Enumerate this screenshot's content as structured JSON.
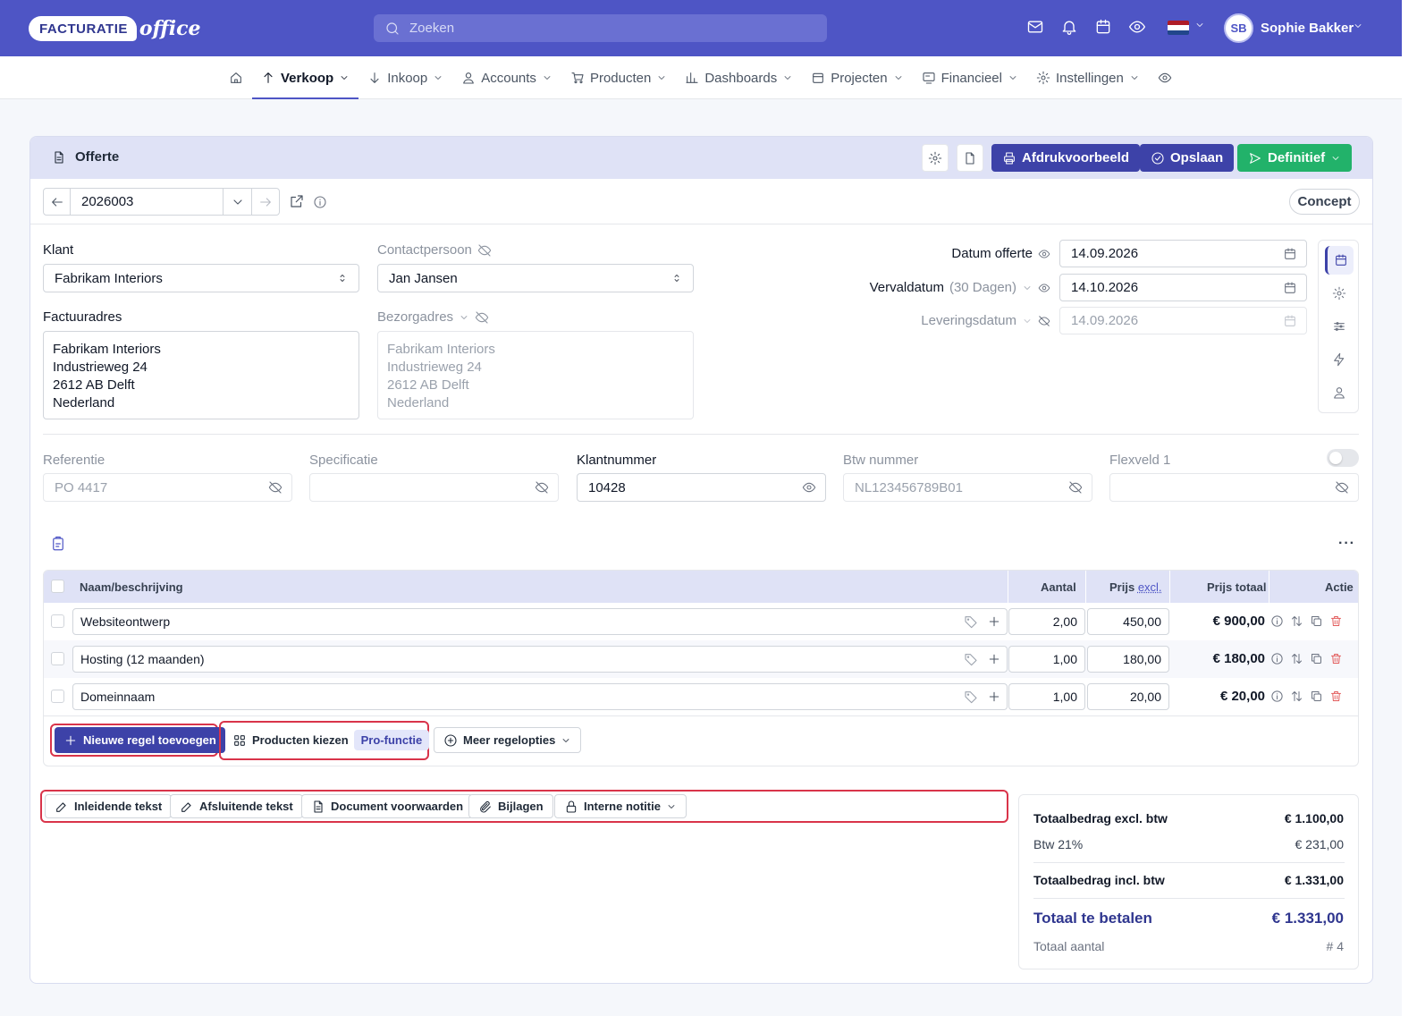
{
  "topbar": {
    "logo_text": "FACTURATIE",
    "logo_script": "office",
    "search_placeholder": "Zoeken",
    "icons": [
      "mail-icon",
      "bell-icon",
      "calendar-icon",
      "eye-icon"
    ],
    "flag_colors": [
      "#ae1c28",
      "#ffffff",
      "#21468b"
    ],
    "user_initials": "SB",
    "user_name": "Sophie Bakker"
  },
  "nav": {
    "items": [
      {
        "label": "Verkoop",
        "active": true
      },
      {
        "label": "Inkoop"
      },
      {
        "label": "Accounts"
      },
      {
        "label": "Producten"
      },
      {
        "label": "Dashboards"
      },
      {
        "label": "Projecten"
      },
      {
        "label": "Financieel"
      },
      {
        "label": "Instellingen"
      }
    ]
  },
  "card": {
    "title": "Offerte",
    "btn_preview": "Afdrukvoorbeeld",
    "btn_save": "Opslaan",
    "btn_final": "Definitief",
    "number": "2026003",
    "status": "Concept"
  },
  "form": {
    "klant_label": "Klant",
    "klant_value": "Fabrikam Interiors",
    "contact_label": "Contactpersoon",
    "contact_value": "Jan Jansen",
    "factuuradres_label": "Factuuradres",
    "factuuradres": [
      "Fabrikam Interiors",
      "Industrieweg 24",
      "2612 AB Delft",
      "Nederland"
    ],
    "bezorgadres_label": "Bezorgadres",
    "bezorgadres": [
      "Fabrikam Interiors",
      "Industrieweg 24",
      "2612 AB Delft",
      "Nederland"
    ],
    "datum_label": "Datum offerte",
    "datum_value": "14.09.2026",
    "verval_label": "Vervaldatum",
    "verval_days": "(30 Dagen)",
    "verval_value": "14.10.2026",
    "levering_label": "Leveringsdatum",
    "levering_value": "14.09.2026",
    "referentie_label": "Referentie",
    "referentie_value": "PO 4417",
    "specificatie_label": "Specificatie",
    "specificatie_value": "",
    "klantnummer_label": "Klantnummer",
    "klantnummer_value": "10428",
    "btw_label": "Btw nummer",
    "btw_value": "NL123456789B01",
    "flex_label": "Flexveld 1",
    "flex_value": ""
  },
  "table": {
    "col_name": "Naam/beschrijving",
    "col_qty": "Aantal",
    "col_price": "Prijs",
    "col_price_suffix": "excl.",
    "col_total": "Prijs totaal",
    "col_action": "Actie",
    "rows": [
      {
        "name": "Websiteontwerp",
        "qty": "2,00",
        "price": "450,00",
        "total": "€ 900,00"
      },
      {
        "name": "Hosting (12 maanden)",
        "qty": "1,00",
        "price": "180,00",
        "total": "€ 180,00"
      },
      {
        "name": "Domeinnaam",
        "qty": "1,00",
        "price": "20,00",
        "total": "€ 20,00"
      }
    ],
    "btn_new_line": "Nieuwe regel toevoegen",
    "btn_products": "Producten kiezen",
    "badge_pro": "Pro-functie",
    "btn_more": "Meer regelopties"
  },
  "extras": {
    "intro": "Inleidende tekst",
    "closing": "Afsluitende tekst",
    "terms": "Document voorwaarden",
    "attachments": "Bijlagen",
    "note": "Interne notitie"
  },
  "totals": {
    "excl_label": "Totaalbedrag excl. btw",
    "excl_value": "€ 1.100,00",
    "vat_label": "Btw 21%",
    "vat_value": "€ 231,00",
    "incl_label": "Totaalbedrag incl. btw",
    "incl_value": "€ 1.331,00",
    "pay_label": "Totaal te betalen",
    "pay_value": "€ 1.331,00",
    "count_label": "Totaal aantal",
    "count_value": "# 4"
  }
}
